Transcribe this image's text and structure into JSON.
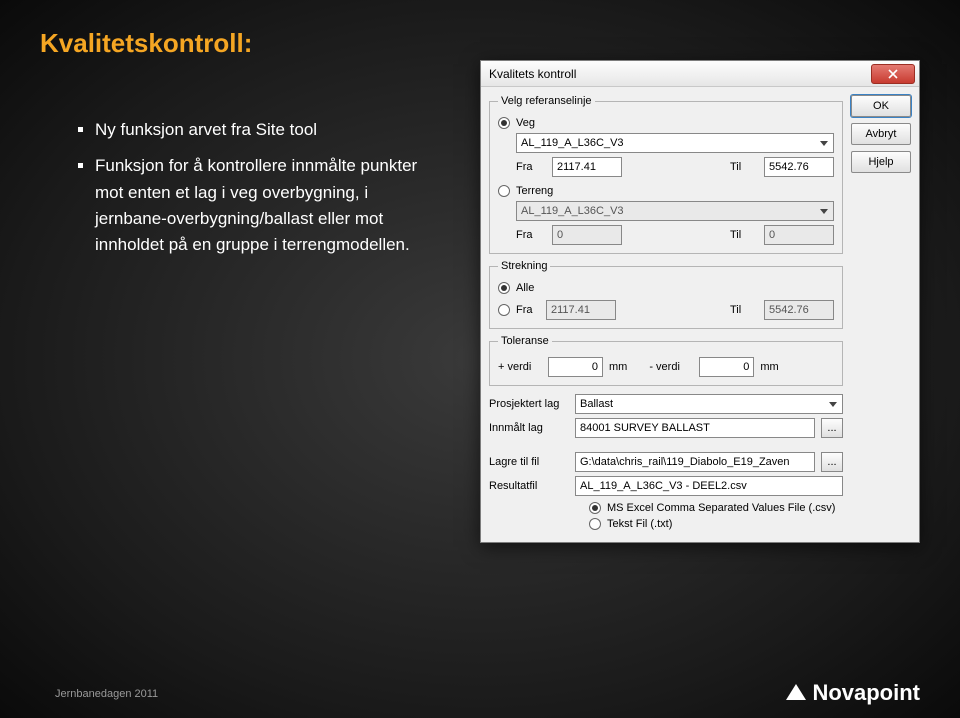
{
  "slide": {
    "title": "Kvalitetskontroll:",
    "bullets": [
      "Ny funksjon arvet fra Site tool",
      "Funksjon for å kontrollere innmålte punkter mot enten et lag i veg overbygning, i jernbane-overbygning/ballast eller mot innholdet på en gruppe i terrengmodellen."
    ],
    "footer": "Jernbanedagen 2011",
    "brand": "Novapoint"
  },
  "dialog": {
    "title": "Kvalitets kontroll",
    "buttons": {
      "ok": "OK",
      "avbryt": "Avbryt",
      "hjelp": "Hjelp"
    },
    "ref": {
      "legend": "Velg referanselinje",
      "veg_label": "Veg",
      "veg_selected": true,
      "veg_value": "AL_119_A_L36C_V3",
      "fra_label": "Fra",
      "til_label": "Til",
      "veg_fra": "2117.41",
      "veg_til": "5542.76",
      "terreng_label": "Terreng",
      "terreng_selected": false,
      "terreng_value": "AL_119_A_L36C_V3",
      "terreng_fra": "0",
      "terreng_til": "0"
    },
    "strekning": {
      "legend": "Strekning",
      "alle_label": "Alle",
      "alle_selected": true,
      "fra_label": "Fra",
      "fra_selected": false,
      "fra_value": "2117.41",
      "til_label": "Til",
      "til_value": "5542.76"
    },
    "toleranse": {
      "legend": "Toleranse",
      "plus_label": "+ verdi",
      "plus_value": "0",
      "minus_label": "- verdi",
      "minus_value": "0",
      "unit": "mm"
    },
    "fields": {
      "prosjektert_lag_label": "Prosjektert lag",
      "prosjektert_lag_value": "Ballast",
      "innmalt_lag_label": "Innmålt lag",
      "innmalt_lag_value": "84001 SURVEY BALLAST",
      "lagre_label": "Lagre til fil",
      "lagre_value": "G:\\data\\chris_rail\\119_Diabolo_E19_Zaven",
      "resultat_label": "Resultatfil",
      "resultat_value": "AL_119_A_L36C_V3 - DEEL2.csv",
      "browse": "..."
    },
    "format": {
      "csv_label": "MS Excel Comma Separated Values File (.csv)",
      "csv_selected": true,
      "txt_label": "Tekst Fil (.txt)",
      "txt_selected": false
    }
  }
}
